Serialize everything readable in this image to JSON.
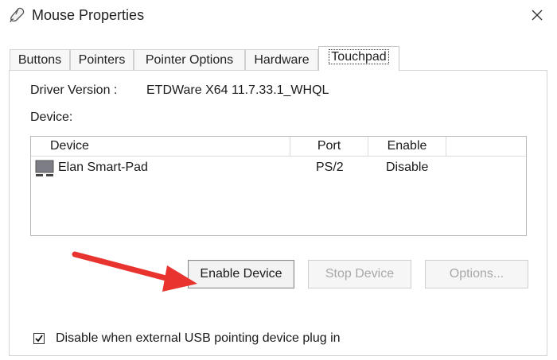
{
  "window": {
    "title": "Mouse Properties"
  },
  "tabs": [
    {
      "label": "Buttons"
    },
    {
      "label": "Pointers"
    },
    {
      "label": "Pointer Options"
    },
    {
      "label": "Hardware"
    },
    {
      "label": "Touchpad",
      "active": true
    }
  ],
  "driver": {
    "label": "Driver Version :",
    "value": "ETDWare X64 11.7.33.1_WHQL"
  },
  "device_section": {
    "label": "Device:"
  },
  "device_table": {
    "columns": [
      "Device",
      "Port",
      "Enable"
    ],
    "rows": [
      {
        "device": "Elan Smart-Pad",
        "port": "PS/2",
        "enable": "Disable",
        "icon": "touchpad-icon"
      }
    ]
  },
  "buttons": {
    "enable_device": "Enable Device",
    "stop_device": "Stop Device",
    "options": "Options..."
  },
  "checkbox": {
    "label": "Disable when external USB pointing device plug in",
    "checked": true
  },
  "colors": {
    "annotation_arrow": "#e8332f"
  }
}
